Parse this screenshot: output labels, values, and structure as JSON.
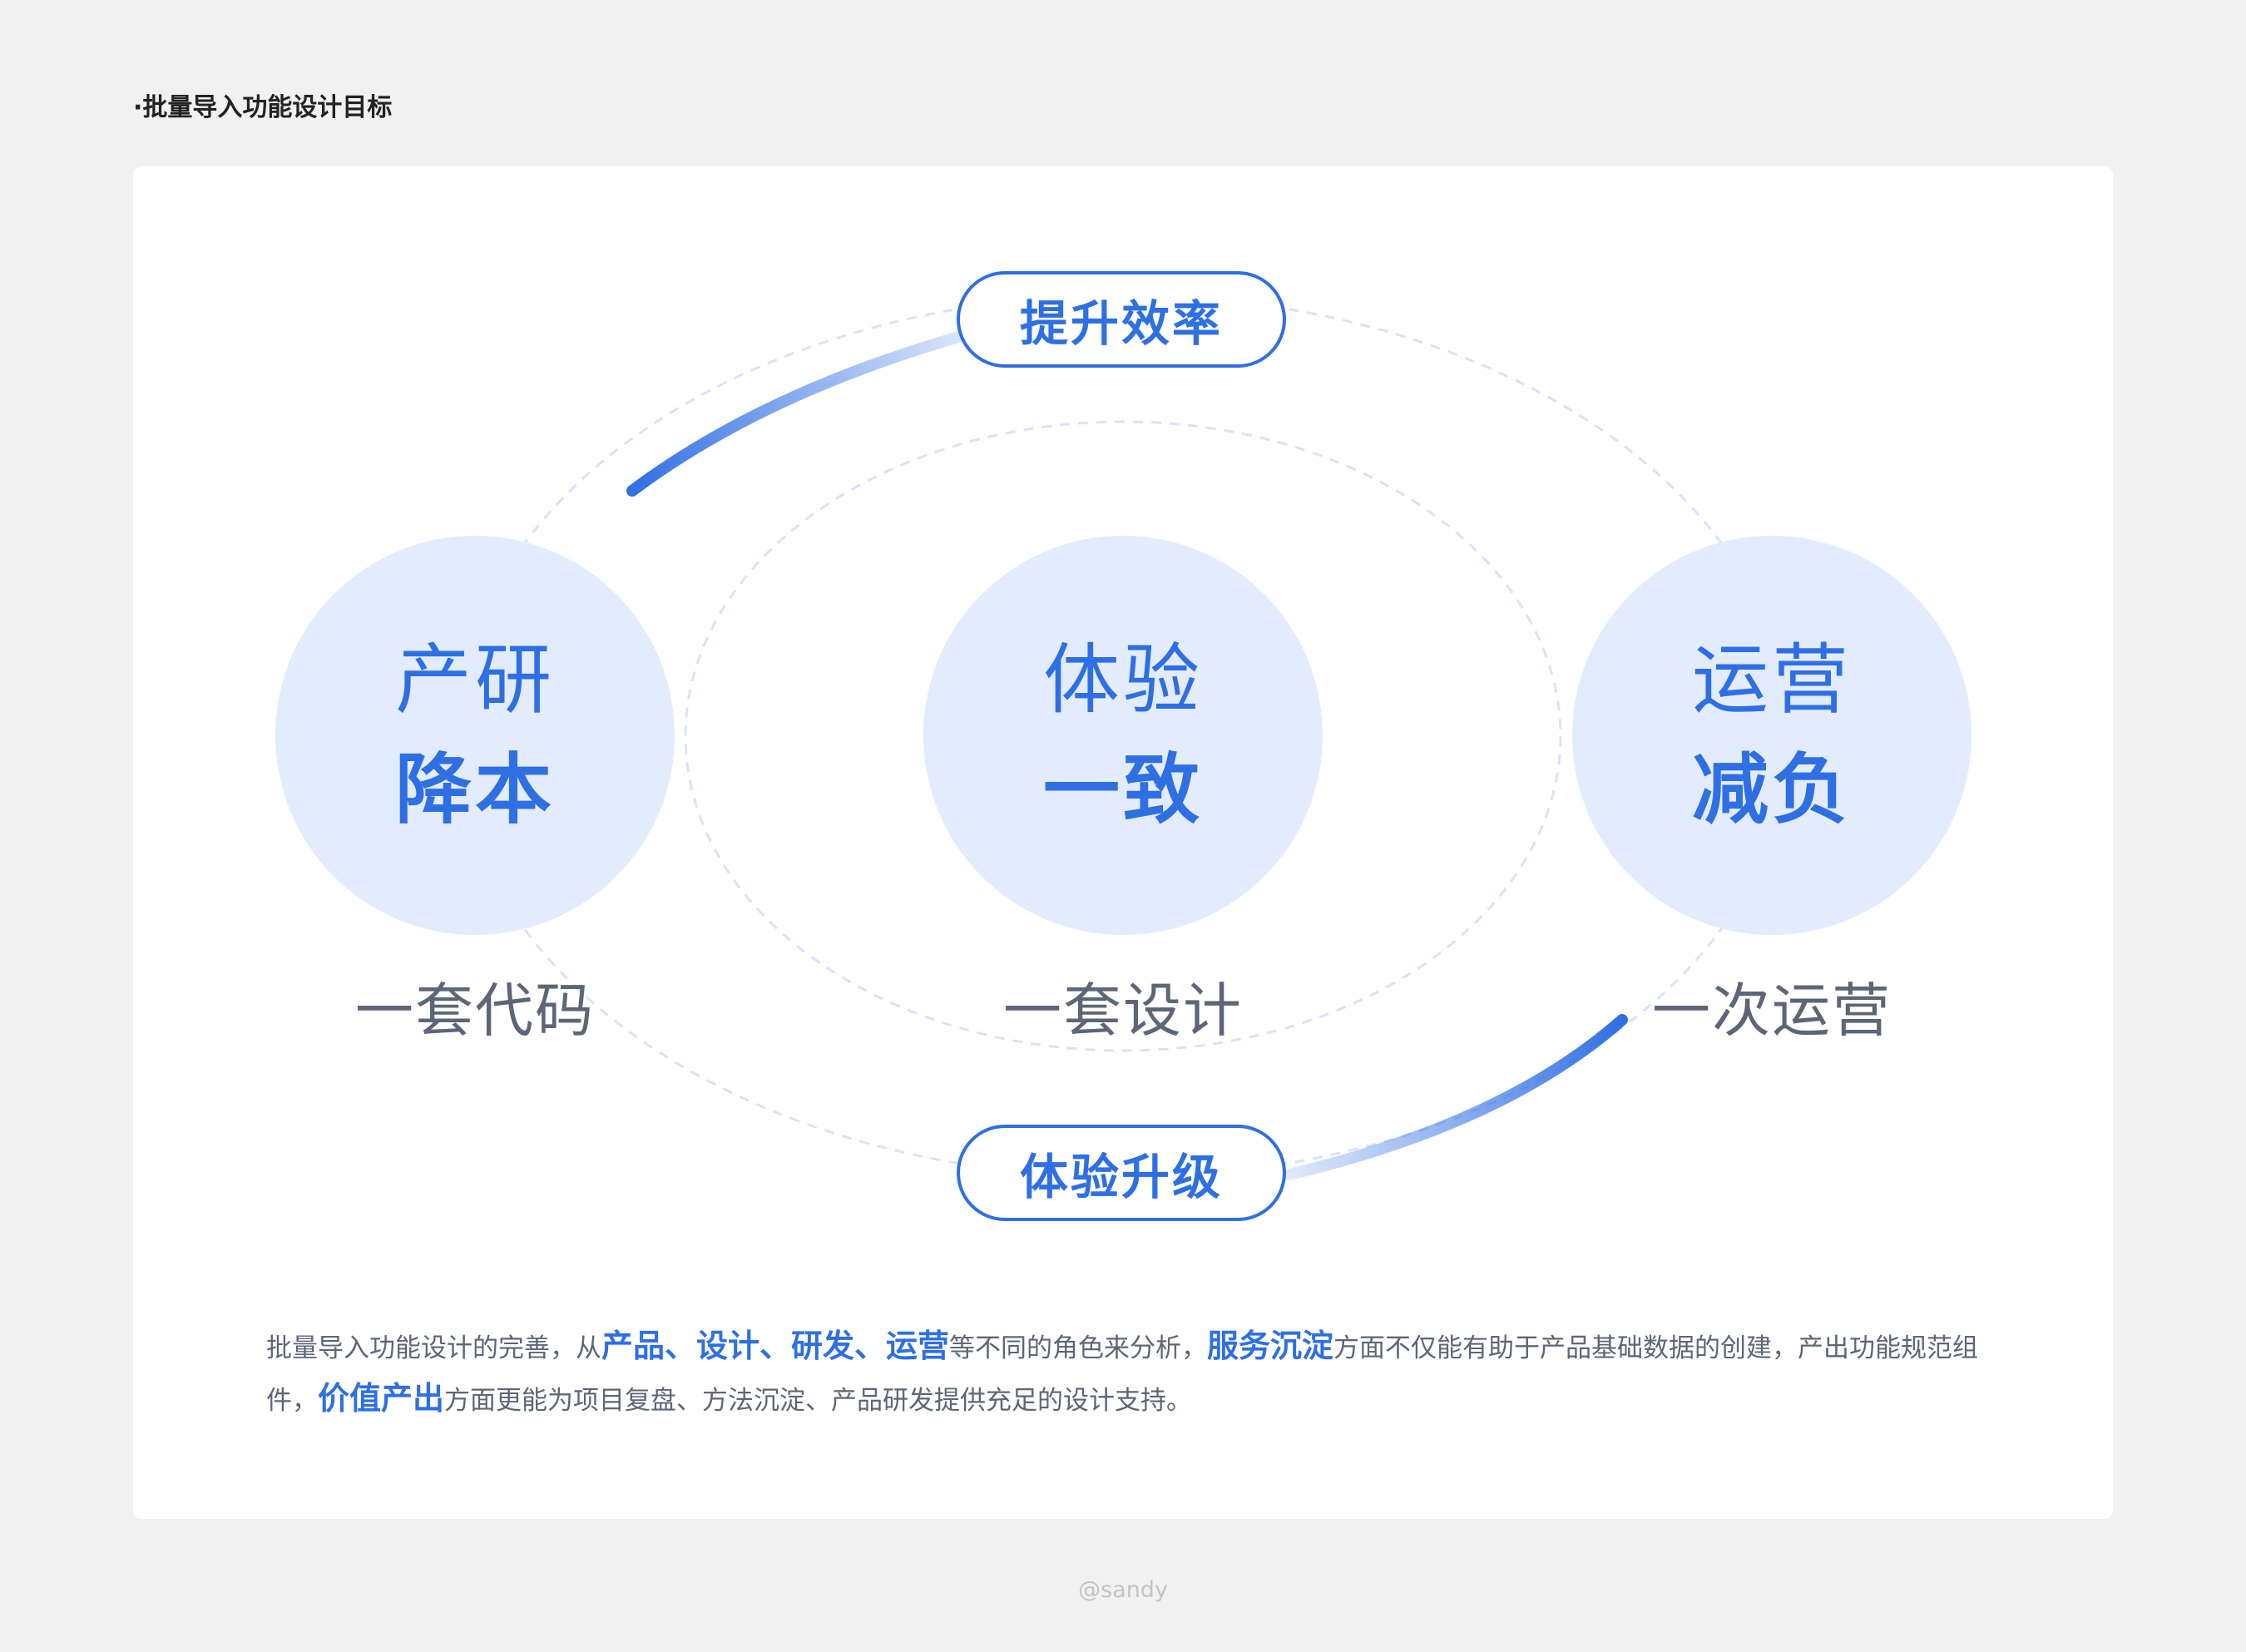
{
  "page": {
    "heading": "·批量导入功能设计目标",
    "watermark": "@sandy"
  },
  "diagram": {
    "nodes": [
      {
        "line1": "产研",
        "line2": "降本",
        "caption": "一套代码"
      },
      {
        "line1": "体验",
        "line2": "一致",
        "caption": "一套设计"
      },
      {
        "line1": "运营",
        "line2": "减负",
        "caption": "一次运营"
      }
    ],
    "pills": {
      "top": "提升效率",
      "bottom": "体验升级"
    }
  },
  "description": {
    "parts": [
      {
        "text": "批量导入功能设计的完善，从",
        "hl": false
      },
      {
        "text": "产品、设计、研发、运营",
        "hl": true
      },
      {
        "text": "等不同的角色来分析，",
        "hl": false
      },
      {
        "text": "服务沉淀",
        "hl": true
      },
      {
        "text": "方面不仅能有助于产品基础数据的创建，产出功能规范组件，",
        "hl": false
      },
      {
        "text": "价值产出",
        "hl": true
      },
      {
        "text": "方面更能为项目复盘、方法沉淀、产品研发提供充足的设计支持。",
        "hl": false
      }
    ]
  },
  "colors": {
    "accent": "#2f6fe4",
    "circle_fill": "#e3ecfd",
    "caption": "#5d6677",
    "background": "#f1f1f1",
    "card": "#ffffff"
  }
}
